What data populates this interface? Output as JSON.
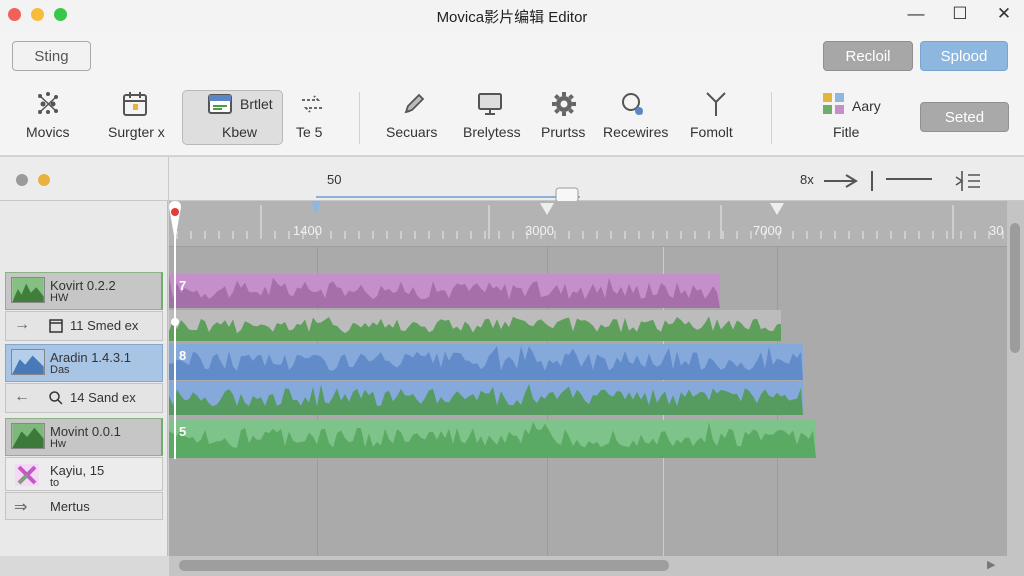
{
  "window": {
    "title": "Movica影片编辑 Editor",
    "controls": {
      "minimize": "—",
      "maximize": "☐",
      "close": "✕"
    }
  },
  "toolbar": {
    "sting_label": "Sting",
    "recoil_label": "Recloil",
    "splood_label": "Splood",
    "seted_label": "Seted",
    "tools": [
      {
        "label": "Movics",
        "icon": "sparkle-icon"
      },
      {
        "label": "Surgter x",
        "icon": "calendar-icon"
      },
      {
        "label": "Brtlet",
        "sublabel": "Kbew",
        "icon": "clip-card-icon"
      },
      {
        "label": "Te  5",
        "icon": "transition-arrows-icon"
      },
      {
        "label": "Secuars",
        "icon": "pen-icon"
      },
      {
        "label": "Brelytess",
        "icon": "monitor-icon"
      },
      {
        "label": "Prurtss",
        "icon": "gear-icon"
      },
      {
        "label": "Recewires",
        "icon": "search-badge-icon"
      },
      {
        "label": "Fomolt",
        "icon": "antenna-icon"
      },
      {
        "label": "Aary",
        "sublabel": "Fitle",
        "icon": "color-grid-icon"
      }
    ]
  },
  "panel": {
    "position_value": "50",
    "zoom_label": "8x"
  },
  "ruler": {
    "labels": [
      "1400",
      "3000",
      "7000",
      "30"
    ]
  },
  "tracks": [
    {
      "name": "Kovirt 0.2.2",
      "sub": "HW"
    },
    {
      "line": "11 Smed ex"
    },
    {
      "name": "Aradin 1.4.3.1",
      "sub": "Das"
    },
    {
      "line": "14 Sand ex"
    },
    {
      "name": "Movint 0.0.1",
      "sub": "Hw"
    },
    {
      "name": "Kayiu, 15",
      "sub": "to"
    },
    {
      "line": "Mertus"
    }
  ],
  "clips": [
    {
      "number": "7",
      "color": "#c58fca",
      "wave": "#9f6ba5"
    },
    {
      "number": "",
      "color": "#bcbcbc",
      "wave": "#4f9a4b"
    },
    {
      "number": "8",
      "color": "#86a9dc",
      "wave": "#5b86c6"
    },
    {
      "number": "",
      "color": "#86a9dc",
      "wave": "#4e9a4a"
    },
    {
      "number": "5",
      "color": "#7ec48a",
      "wave": "#55a65c"
    }
  ]
}
